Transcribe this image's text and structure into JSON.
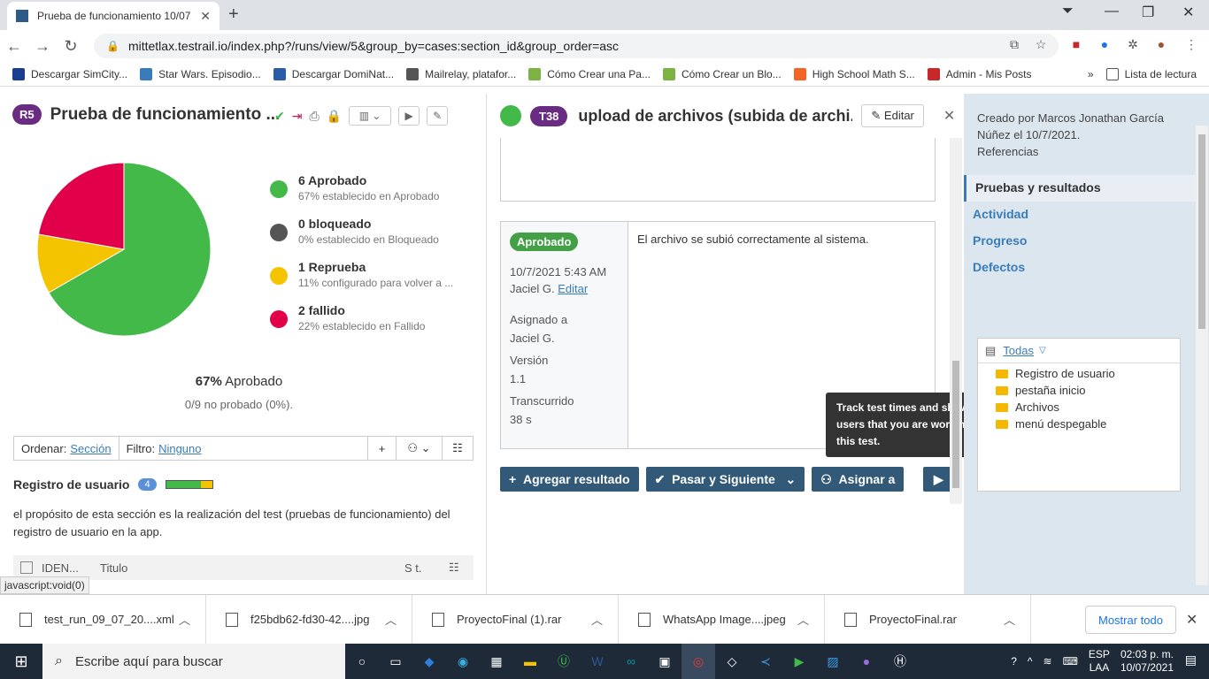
{
  "browser": {
    "tab_title": "Prueba de funcionamiento 10/07",
    "url": "mittetlax.testrail.io/index.php?/runs/view/5&group_by=cases:section_id&group_order=asc",
    "bookmarks": [
      {
        "label": "Descargar SimCity...",
        "color": "#1a3d8f"
      },
      {
        "label": "Star Wars. Episodio...",
        "color": "#3a7cba"
      },
      {
        "label": "Descargar DomiNat...",
        "color": "#2a5caa"
      },
      {
        "label": "Mailrelay, platafor...",
        "color": "#555555"
      },
      {
        "label": "Cómo Crear una Pa...",
        "color": "#7cb342"
      },
      {
        "label": "Cómo Crear un Blo...",
        "color": "#7cb342"
      },
      {
        "label": "High School Math S...",
        "color": "#f26522"
      },
      {
        "label": "Admin - Mis Posts",
        "color": "#c62828"
      }
    ],
    "reading_list": "Lista de lectura"
  },
  "run": {
    "badge": "R5",
    "title": "Prueba de funcionamiento ..."
  },
  "chart_data": {
    "type": "pie",
    "categories": [
      "Aprobado",
      "bloqueado",
      "Reprueba",
      "fallido"
    ],
    "values": [
      6,
      0,
      1,
      2
    ],
    "colors": [
      "#43b94a",
      "#555555",
      "#f5c400",
      "#e3004a"
    ]
  },
  "legend": [
    {
      "title": "6 Aprobado",
      "sub": "67% establecido en Aprobado",
      "color": "#43b94a"
    },
    {
      "title": "0 bloqueado",
      "sub": "0% establecido en Bloqueado",
      "color": "#555555"
    },
    {
      "title": "1 Reprueba",
      "sub": "11% configurado para volver a ...",
      "color": "#f5c400"
    },
    {
      "title": "2 fallido",
      "sub": "22% establecido en Fallido",
      "color": "#e3004a"
    }
  ],
  "summary": {
    "pct": "67%",
    "pct_label": "Aprobado",
    "untested": "0/9 no probado (0%)."
  },
  "filter": {
    "sort_label": "Ordenar:",
    "sort_value": "Sección",
    "filter_label": "Filtro:",
    "filter_value": "Ninguno"
  },
  "section": {
    "title": "Registro de usuario",
    "count": "4",
    "description": "el propósito de esta sección es la realización del test (pruebas de funcionamiento) del registro de usuario en la app."
  },
  "table": {
    "col_id": "IDEN...",
    "col_title": "Titulo",
    "col_status": "S t."
  },
  "status_tip": "javascript:void(0)",
  "test": {
    "badge": "T38",
    "title": "upload de archivos (subida de archi...",
    "edit_label": "Editar"
  },
  "result": {
    "status": "Aprobado",
    "datetime": "10/7/2021 5:43 AM",
    "user": "Jaciel G.",
    "edit_link": "Editar",
    "assigned_label": "Asignado a",
    "assigned": "Jaciel G.",
    "version_label": "Versión",
    "version": "1.1",
    "elapsed_label": "Transcurrido",
    "elapsed": "38 s",
    "comment": "El archivo se subió correctamente al sistema."
  },
  "actions": {
    "add": "Agregar resultado",
    "pass_next": "Pasar y Siguiente",
    "assign": "Asignar a"
  },
  "tooltip": "Track test times and show other users that you are working on this test.",
  "right": {
    "created": "Creado por Marcos Jonathan García Núñez el 10/7/2021.",
    "refs": "Referencias",
    "nav": [
      "Pruebas y resultados",
      "Actividad",
      "Progreso",
      "Defectos"
    ],
    "tree_head": "Todas",
    "tree_items": [
      "Registro de usuario",
      "pestaña inicio",
      "Archivos",
      "menú despegable"
    ]
  },
  "downloads": {
    "items": [
      "test_run_09_07_20....xml",
      "f25bdb62-fd30-42....jpg",
      "ProyectoFinal (1).rar",
      "WhatsApp Image....jpeg",
      "ProyectoFinal.rar"
    ],
    "show_all": "Mostrar todo"
  },
  "taskbar": {
    "search": "Escribe aquí para buscar",
    "lang1": "ESP",
    "lang2": "LAA",
    "time": "02:03 p. m.",
    "date": "10/07/2021"
  }
}
